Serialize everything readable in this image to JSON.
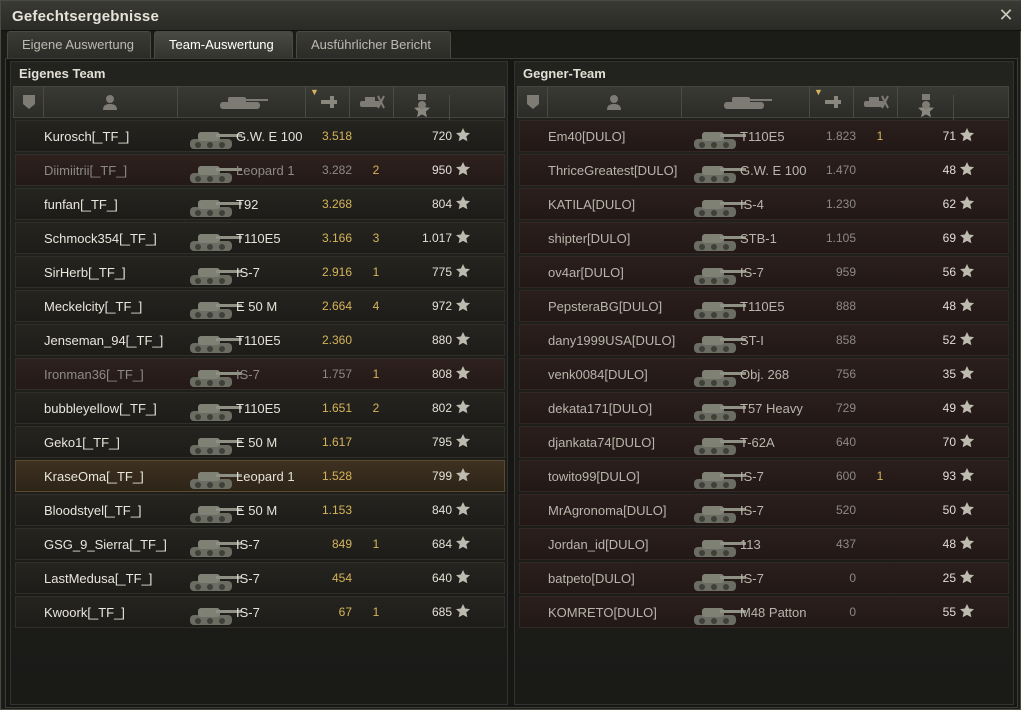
{
  "window": {
    "title": "Gefechtsergebnisse",
    "close_glyph": "✕"
  },
  "tabs": [
    {
      "label": "Eigene Auswertung",
      "active": false
    },
    {
      "label": "Team-Auswertung",
      "active": true
    },
    {
      "label": "Ausführlicher Bericht",
      "active": false
    }
  ],
  "columns": [
    "squad-icon",
    "player-icon",
    "vehicle-icon",
    "damage-icon",
    "kills-icon",
    "xp-star-icon",
    "medal-icon"
  ],
  "sort_indicator": "▼",
  "colors": {
    "accent": "#d6b45a",
    "dead_name": "#8d8a83",
    "highlight_row": "#3e3121",
    "enemy_row": "#2b1f1d"
  },
  "left": {
    "title": "Eigenes Team",
    "rows": [
      {
        "player": "Kurosch[_TF_]",
        "vehicle": "G.W. E 100",
        "damage": "3.518",
        "kills": "",
        "xp": "720"
      },
      {
        "player": "Diimiitrii[_TF_]",
        "vehicle": "Leopard 1",
        "damage": "3.282",
        "kills": "2",
        "xp": "950"
      },
      {
        "player": "funfan[_TF_]",
        "vehicle": "T92",
        "damage": "3.268",
        "kills": "",
        "xp": "804"
      },
      {
        "player": "Schmock354[_TF_]",
        "vehicle": "T110E5",
        "damage": "3.166",
        "kills": "3",
        "xp": "1.017"
      },
      {
        "player": "SirHerb[_TF_]",
        "vehicle": "IS-7",
        "damage": "2.916",
        "kills": "1",
        "xp": "775"
      },
      {
        "player": "Meckelcity[_TF_]",
        "vehicle": "E 50 M",
        "damage": "2.664",
        "kills": "4",
        "xp": "972"
      },
      {
        "player": "Jenseman_94[_TF_]",
        "vehicle": "T110E5",
        "damage": "2.360",
        "kills": "",
        "xp": "880"
      },
      {
        "player": "Ironman36[_TF_]",
        "vehicle": "IS-7",
        "damage": "1.757",
        "kills": "1",
        "xp": "808"
      },
      {
        "player": "bubbleyellow[_TF_]",
        "vehicle": "T110E5",
        "damage": "1.651",
        "kills": "2",
        "xp": "802"
      },
      {
        "player": "Geko1[_TF_]",
        "vehicle": "E 50 M",
        "damage": "1.617",
        "kills": "",
        "xp": "795"
      },
      {
        "player": "KraseOma[_TF_]",
        "vehicle": "Leopard 1",
        "damage": "1.528",
        "kills": "",
        "xp": "799"
      },
      {
        "player": "Bloodstyel[_TF_]",
        "vehicle": "E 50 M",
        "damage": "1.153",
        "kills": "",
        "xp": "840"
      },
      {
        "player": "GSG_9_Sierra[_TF_]",
        "vehicle": "IS-7",
        "damage": "849",
        "kills": "1",
        "xp": "684"
      },
      {
        "player": "LastMedusa[_TF_]",
        "vehicle": "IS-7",
        "damage": "454",
        "kills": "",
        "xp": "640"
      },
      {
        "player": "Kwoork[_TF_]",
        "vehicle": "IS-7",
        "damage": "67",
        "kills": "1",
        "xp": "685"
      }
    ]
  },
  "right": {
    "title": "Gegner-Team",
    "rows": [
      {
        "player": "Em40[DULO]",
        "vehicle": "T110E5",
        "damage": "1.823",
        "kills": "1",
        "xp": "71"
      },
      {
        "player": "ThriceGreatest[DULO]",
        "vehicle": "G.W. E 100",
        "damage": "1.470",
        "kills": "",
        "xp": "48"
      },
      {
        "player": "KATILA[DULO]",
        "vehicle": "IS-4",
        "damage": "1.230",
        "kills": "",
        "xp": "62"
      },
      {
        "player": "shipter[DULO]",
        "vehicle": "STB-1",
        "damage": "1.105",
        "kills": "",
        "xp": "69"
      },
      {
        "player": "ov4ar[DULO]",
        "vehicle": "IS-7",
        "damage": "959",
        "kills": "",
        "xp": "56"
      },
      {
        "player": "PepsteraBG[DULO]",
        "vehicle": "T110E5",
        "damage": "888",
        "kills": "",
        "xp": "48"
      },
      {
        "player": "dany1999USA[DULO]",
        "vehicle": "ST-I",
        "damage": "858",
        "kills": "",
        "xp": "52"
      },
      {
        "player": "venk0084[DULO]",
        "vehicle": "Obj. 268",
        "damage": "756",
        "kills": "",
        "xp": "35"
      },
      {
        "player": "dekata171[DULO]",
        "vehicle": "T57 Heavy",
        "damage": "729",
        "kills": "",
        "xp": "49"
      },
      {
        "player": "djankata74[DULO]",
        "vehicle": "T-62A",
        "damage": "640",
        "kills": "",
        "xp": "70"
      },
      {
        "player": "towito99[DULO]",
        "vehicle": "IS-7",
        "damage": "600",
        "kills": "1",
        "xp": "93"
      },
      {
        "player": "MrAgronoma[DULO]",
        "vehicle": "IS-7",
        "damage": "520",
        "kills": "",
        "xp": "50"
      },
      {
        "player": "Jordan_id[DULO]",
        "vehicle": "113",
        "damage": "437",
        "kills": "",
        "xp": "48"
      },
      {
        "player": "batpeto[DULO]",
        "vehicle": "IS-7",
        "damage": "0",
        "kills": "",
        "xp": "25"
      },
      {
        "player": "KOMRETO[DULO]",
        "vehicle": "M48 Patton",
        "damage": "0",
        "kills": "",
        "xp": "55"
      }
    ]
  }
}
